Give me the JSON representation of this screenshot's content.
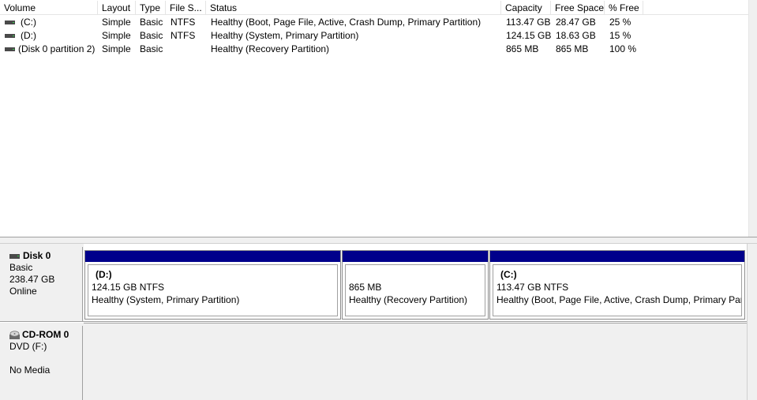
{
  "volume_list": {
    "columns": [
      "Volume",
      "Layout",
      "Type",
      "File S...",
      "Status",
      "Capacity",
      "Free Space",
      "% Free"
    ],
    "rows": [
      {
        "volume": "(C:)",
        "layout": "Simple",
        "type": "Basic",
        "fs": "NTFS",
        "status": "Healthy (Boot, Page File, Active, Crash Dump, Primary Partition)",
        "capacity": "113.47 GB",
        "free": "28.47 GB",
        "pct": "25 %"
      },
      {
        "volume": "(D:)",
        "layout": "Simple",
        "type": "Basic",
        "fs": "NTFS",
        "status": "Healthy (System, Primary Partition)",
        "capacity": "124.15 GB",
        "free": "18.63 GB",
        "pct": "15 %"
      },
      {
        "volume": "(Disk 0 partition 2)",
        "layout": "Simple",
        "type": "Basic",
        "fs": "",
        "status": "Healthy (Recovery Partition)",
        "capacity": "865 MB",
        "free": "865 MB",
        "pct": "100 %"
      }
    ]
  },
  "disk0": {
    "name": "Disk 0",
    "type": "Basic",
    "size": "238.47 GB",
    "state": "Online",
    "partitions": [
      {
        "title": "(D:)",
        "size": "124.15 GB NTFS",
        "status": "Healthy (System, Primary Partition)"
      },
      {
        "title": "",
        "size": "865 MB",
        "status": "Healthy (Recovery Partition)"
      },
      {
        "title": "(C:)",
        "size": "113.47 GB NTFS",
        "status": "Healthy (Boot, Page File, Active, Crash Dump, Primary Part"
      }
    ]
  },
  "cdrom0": {
    "name": "CD-ROM 0",
    "type": "DVD (F:)",
    "media": "No Media"
  },
  "colors": {
    "partition_bar": "#00008b",
    "pane_bg": "#f0f0f0"
  }
}
